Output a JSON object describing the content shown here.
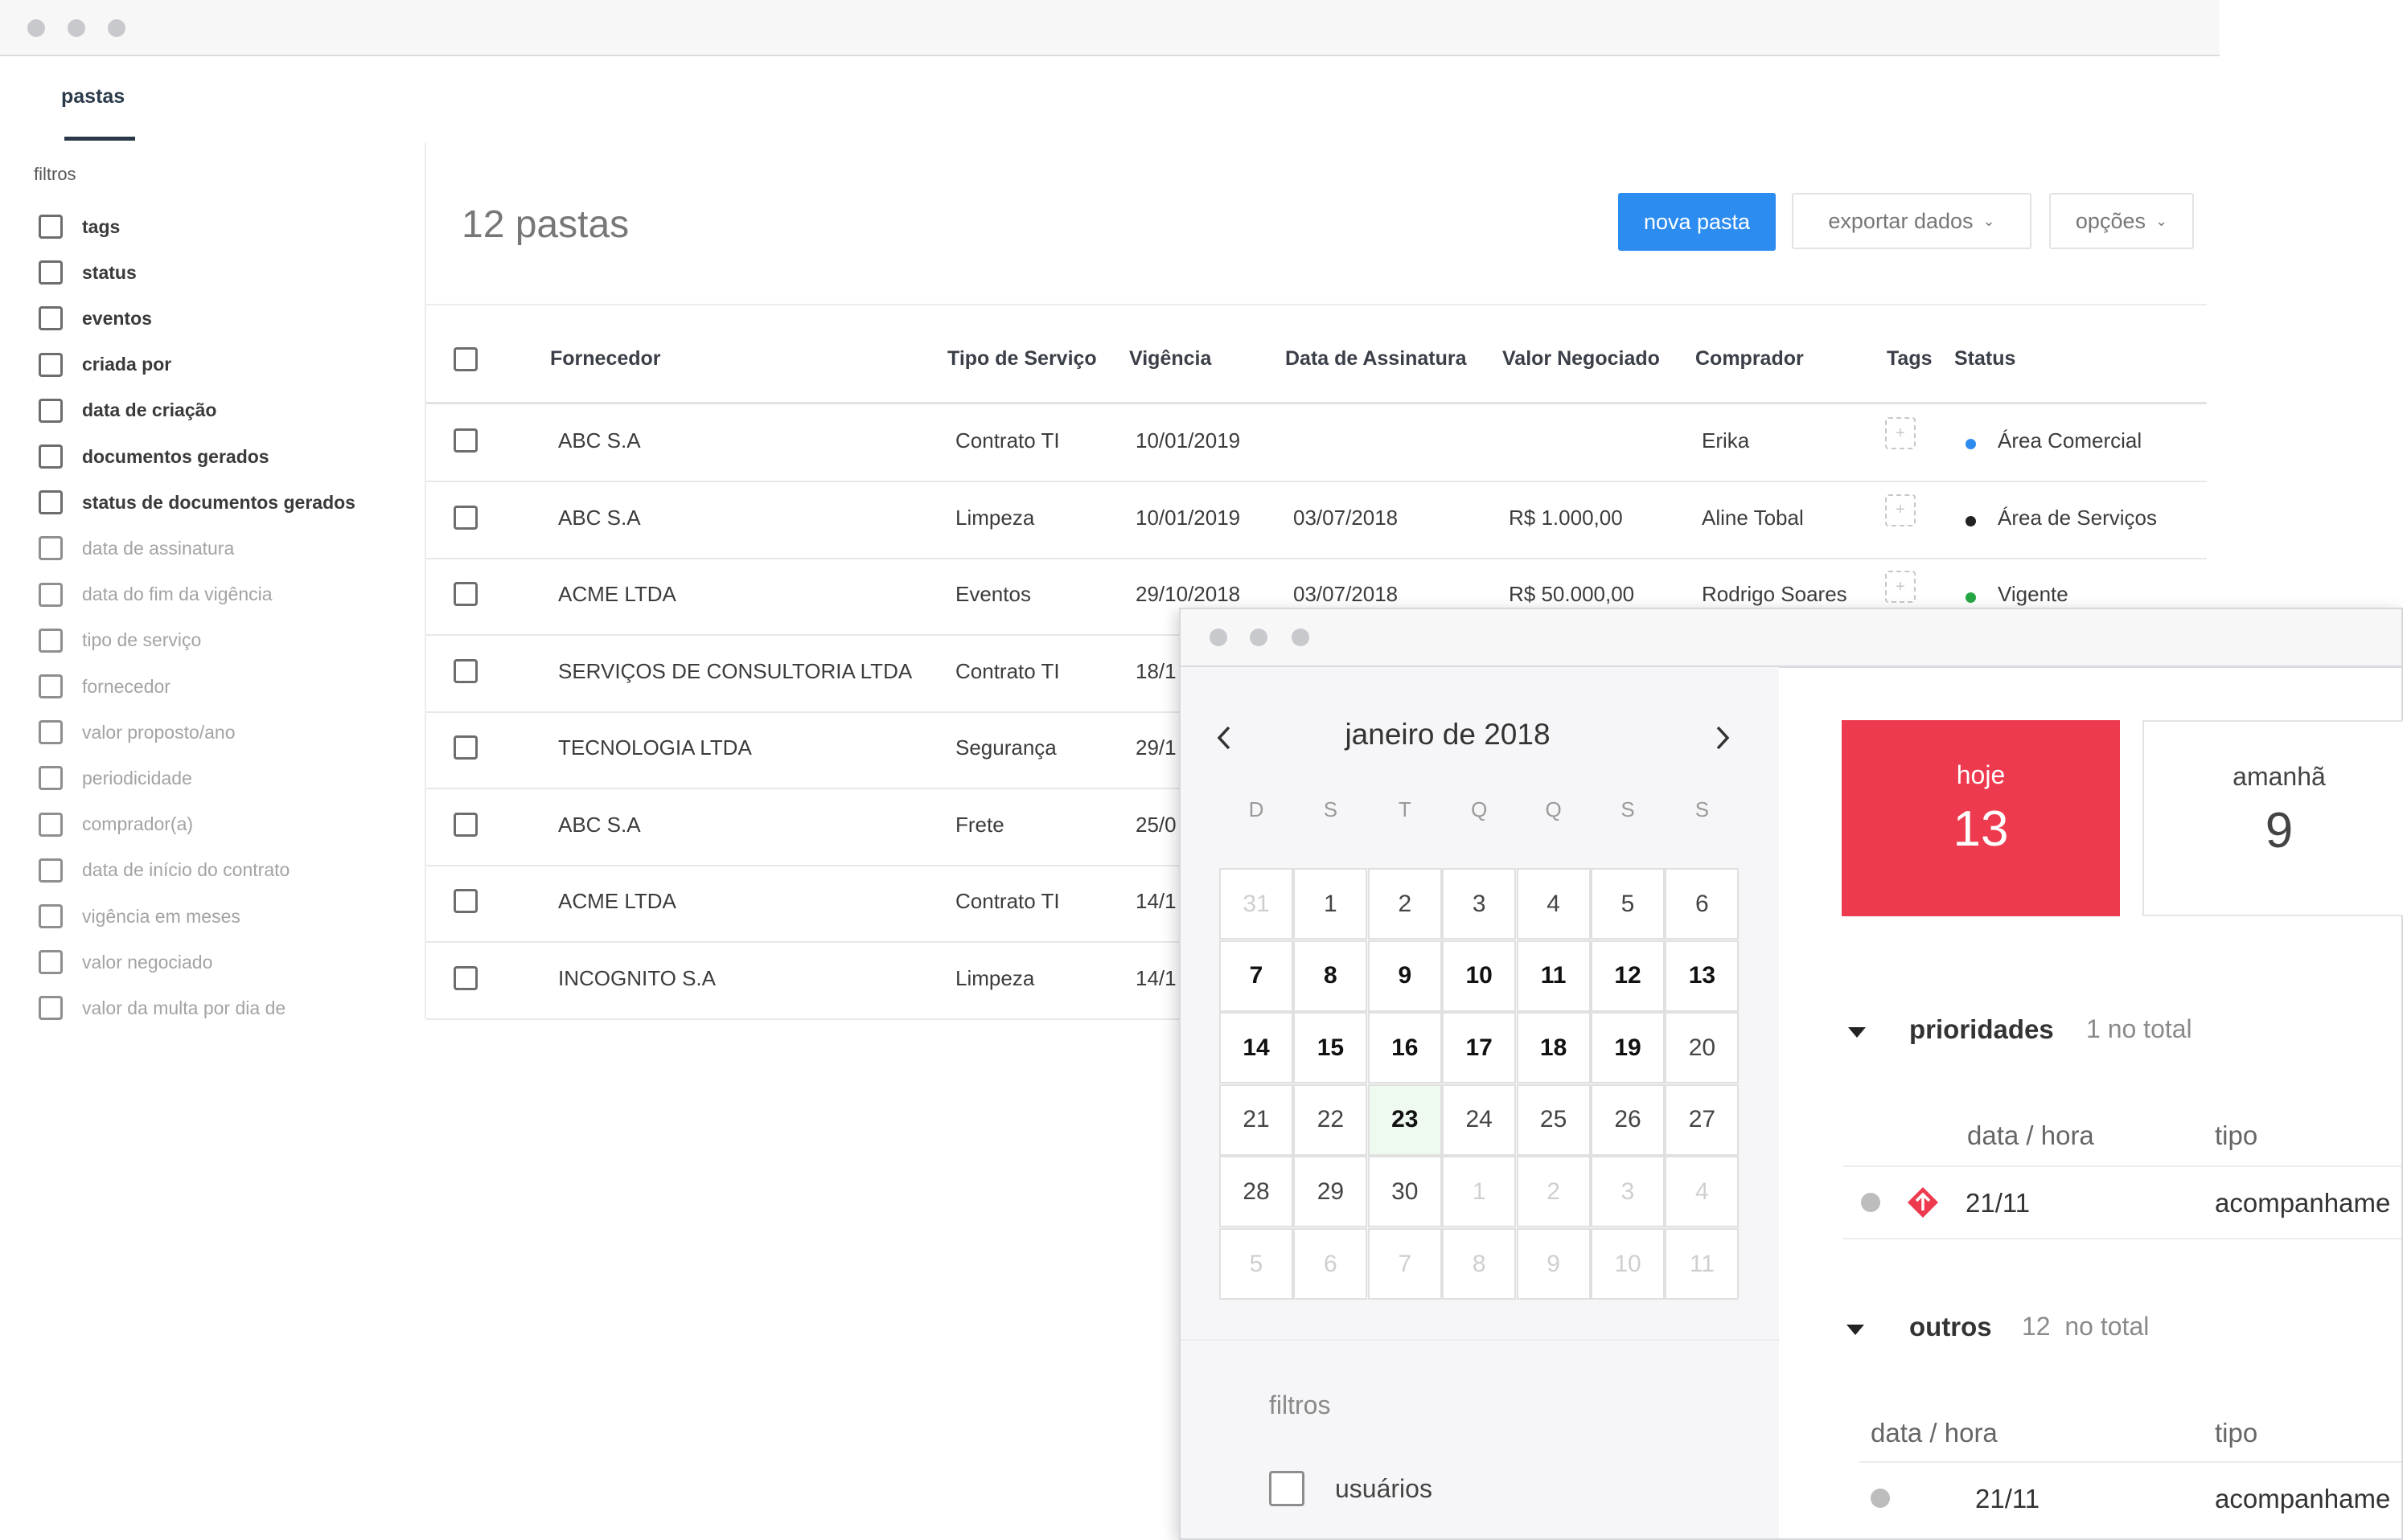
{
  "main_window": {
    "tab": "pastas",
    "filters": {
      "title": "filtros",
      "items": [
        {
          "label": "tags",
          "style": "strong"
        },
        {
          "label": "status",
          "style": "strong"
        },
        {
          "label": "eventos",
          "style": "strong"
        },
        {
          "label": "criada por",
          "style": "strong"
        },
        {
          "label": "data de criação",
          "style": "strong"
        },
        {
          "label": "documentos gerados",
          "style": "strong"
        },
        {
          "label": "status de documentos gerados",
          "style": "strong"
        },
        {
          "label": "data de assinatura",
          "style": "light"
        },
        {
          "label": "data do fim da vigência",
          "style": "light"
        },
        {
          "label": "tipo de serviço",
          "style": "light"
        },
        {
          "label": "fornecedor",
          "style": "light"
        },
        {
          "label": "valor proposto/ano",
          "style": "light"
        },
        {
          "label": "periodicidade",
          "style": "light"
        },
        {
          "label": "comprador(a)",
          "style": "light"
        },
        {
          "label": "data de início do contrato",
          "style": "light"
        },
        {
          "label": "vigência em meses",
          "style": "light"
        },
        {
          "label": "valor negociado",
          "style": "light"
        },
        {
          "label": "valor da multa por dia de",
          "style": "light"
        }
      ]
    },
    "count": "12 pastas",
    "buttons": {
      "nova": "nova pasta",
      "exportar": "exportar dados",
      "opcoes": "opções",
      "chevron_icon": "chevron-down-icon"
    },
    "table": {
      "columns": [
        "Fornecedor",
        "Tipo de Serviço",
        "Vigência",
        "Data de Assinatura",
        "Valor Negociado",
        "Comprador",
        "Tags",
        "Status"
      ],
      "rows": [
        {
          "fornecedor": "ABC S.A",
          "tipo": "Contrato TI",
          "vigencia": "10/01/2019",
          "assinatura": "",
          "valor": "",
          "comprador": "Erika",
          "tag": "+",
          "status": "Área Comercial",
          "status_color": "#2d8cf0"
        },
        {
          "fornecedor": "ABC S.A",
          "tipo": "Limpeza",
          "vigencia": "10/01/2019",
          "assinatura": "03/07/2018",
          "valor": "R$ 1.000,00",
          "comprador": "Aline Tobal",
          "tag": "+",
          "status": "Área de Serviços",
          "status_color": "#222222"
        },
        {
          "fornecedor": "ACME LTDA",
          "tipo": "Eventos",
          "vigencia": "29/10/2018",
          "assinatura": "03/07/2018",
          "valor": "R$ 50.000,00",
          "comprador": "Rodrigo Soares",
          "tag": "+",
          "status": "Vigente",
          "status_color": "#27a744"
        },
        {
          "fornecedor": "SERVIÇOS DE CONSULTORIA LTDA",
          "tipo": "Contrato TI",
          "vigencia": "18/1",
          "assinatura": "",
          "valor": "",
          "comprador": "",
          "tag": "",
          "status": "",
          "status_color": ""
        },
        {
          "fornecedor": "TECNOLOGIA LTDA",
          "tipo": "Segurança",
          "vigencia": "29/1",
          "assinatura": "",
          "valor": "",
          "comprador": "",
          "tag": "",
          "status": "",
          "status_color": ""
        },
        {
          "fornecedor": "ABC S.A",
          "tipo": "Frete",
          "vigencia": "25/0",
          "assinatura": "",
          "valor": "",
          "comprador": "",
          "tag": "",
          "status": "",
          "status_color": ""
        },
        {
          "fornecedor": "ACME LTDA",
          "tipo": "Contrato TI",
          "vigencia": "14/1",
          "assinatura": "",
          "valor": "",
          "comprador": "",
          "tag": "",
          "status": "",
          "status_color": ""
        },
        {
          "fornecedor": "INCOGNITO S.A",
          "tipo": "Limpeza",
          "vigencia": "14/1",
          "assinatura": "",
          "valor": "",
          "comprador": "",
          "tag": "",
          "status": "",
          "status_color": ""
        }
      ]
    },
    "colors": {
      "primary": "#2d8cf0"
    }
  },
  "calendar_window": {
    "month": "janeiro de 2018",
    "prev_icon": "chevron-left-icon",
    "next_icon": "chevron-right-icon",
    "weekdays": [
      "D",
      "S",
      "T",
      "Q",
      "Q",
      "S",
      "S"
    ],
    "weeks": [
      [
        {
          "d": "31",
          "t": "other"
        },
        {
          "d": "1",
          "t": "cur"
        },
        {
          "d": "2",
          "t": "cur"
        },
        {
          "d": "3",
          "t": "cur"
        },
        {
          "d": "4",
          "t": "cur"
        },
        {
          "d": "5",
          "t": "cur"
        },
        {
          "d": "6",
          "t": "cur"
        }
      ],
      [
        {
          "d": "7",
          "t": "bold"
        },
        {
          "d": "8",
          "t": "bold"
        },
        {
          "d": "9",
          "t": "bold"
        },
        {
          "d": "10",
          "t": "bold"
        },
        {
          "d": "11",
          "t": "bold"
        },
        {
          "d": "12",
          "t": "bold"
        },
        {
          "d": "13",
          "t": "bold"
        }
      ],
      [
        {
          "d": "14",
          "t": "bold"
        },
        {
          "d": "15",
          "t": "bold"
        },
        {
          "d": "16",
          "t": "bold"
        },
        {
          "d": "17",
          "t": "bold"
        },
        {
          "d": "18",
          "t": "bold"
        },
        {
          "d": "19",
          "t": "bold"
        },
        {
          "d": "20",
          "t": "cur"
        }
      ],
      [
        {
          "d": "21",
          "t": "cur"
        },
        {
          "d": "22",
          "t": "cur"
        },
        {
          "d": "23",
          "t": "today"
        },
        {
          "d": "24",
          "t": "cur"
        },
        {
          "d": "25",
          "t": "cur"
        },
        {
          "d": "26",
          "t": "cur"
        },
        {
          "d": "27",
          "t": "cur"
        }
      ],
      [
        {
          "d": "28",
          "t": "cur"
        },
        {
          "d": "29",
          "t": "cur"
        },
        {
          "d": "30",
          "t": "cur"
        },
        {
          "d": "1",
          "t": "other"
        },
        {
          "d": "2",
          "t": "other"
        },
        {
          "d": "3",
          "t": "other"
        },
        {
          "d": "4",
          "t": "other"
        }
      ],
      [
        {
          "d": "5",
          "t": "other"
        },
        {
          "d": "6",
          "t": "other"
        },
        {
          "d": "7",
          "t": "other"
        },
        {
          "d": "8",
          "t": "other"
        },
        {
          "d": "9",
          "t": "other"
        },
        {
          "d": "10",
          "t": "other"
        },
        {
          "d": "11",
          "t": "other"
        }
      ]
    ],
    "filters_title": "filtros",
    "filter_users": "usuários",
    "cards": {
      "hoje": {
        "label": "hoje",
        "value": "13",
        "color": "#ee3a4e"
      },
      "amanha": {
        "label": "amanhã",
        "value": "9"
      }
    },
    "prioridades": {
      "title": "prioridades",
      "count": "1 no total",
      "col_date": "data / hora",
      "col_type": "tipo",
      "item": {
        "date": "21/11",
        "type": "acompanhame",
        "icon": "priority-diamond-icon",
        "icon_color": "#ee3a4e"
      }
    },
    "outros": {
      "title": "outros",
      "count": "12  no total",
      "col_date": "data / hora",
      "col_type": "tipo",
      "item": {
        "date": "21/11",
        "type": "acompanhame"
      }
    }
  }
}
